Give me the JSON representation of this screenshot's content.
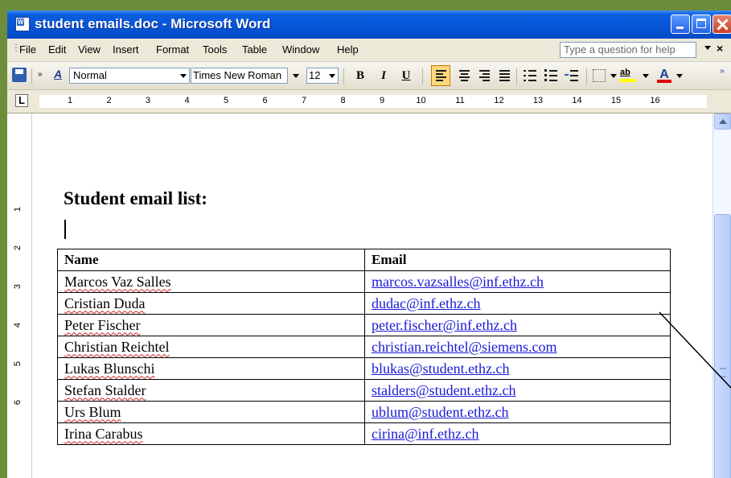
{
  "window": {
    "title": "student emails.doc - Microsoft Word",
    "app_icon": "word-doc-icon",
    "app_icon_letter": "W"
  },
  "menu": {
    "items": [
      "File",
      "Edit",
      "View",
      "Insert",
      "Format",
      "Tools",
      "Table",
      "Window",
      "Help"
    ],
    "help_placeholder": "Type a question for help",
    "close_label": "×"
  },
  "toolbar": {
    "style_icon_label": "A",
    "style": "Normal",
    "font": "Times New Roman",
    "size": "12",
    "bold_label": "B",
    "italic_label": "I",
    "underline_label": "U",
    "highlight_label": "ab",
    "font_color_label": "A",
    "highlight_color": "#ffff00",
    "font_color": "#e00000"
  },
  "ruler": {
    "tab_selector": "L",
    "numbers": [
      "1",
      "2",
      "3",
      "4",
      "5",
      "6",
      "7",
      "8",
      "9",
      "10",
      "11",
      "12",
      "13",
      "14",
      "15",
      "16"
    ],
    "vertical_numbers": [
      "1",
      "2",
      "3",
      "4",
      "5",
      "6"
    ]
  },
  "document": {
    "heading": "Student email list:",
    "table": {
      "headers": [
        "Name",
        "Email"
      ],
      "rows": [
        [
          "Marcos Vaz Salles",
          "marcos.vazsalles@inf.ethz.ch"
        ],
        [
          "Cristian Duda",
          "dudac@inf.ethz.ch"
        ],
        [
          "Peter Fischer",
          "peter.fischer@inf.ethz.ch"
        ],
        [
          "Christian Reichtel",
          "christian.reichtel@siemens.com"
        ],
        [
          "Lukas Blunschi",
          "blukas@student.ethz.ch"
        ],
        [
          "Stefan Stalder",
          "stalders@student.ethz.ch"
        ],
        [
          "Urs Blum",
          "ublum@student.ethz.ch"
        ],
        [
          "Irina Carabus",
          "cirina@inf.ethz.ch"
        ]
      ]
    }
  },
  "colors": {
    "titlebar": "#0654d6",
    "link": "#1a1ad6",
    "spell_error": "#d02020"
  }
}
